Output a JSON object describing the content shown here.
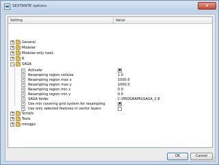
{
  "window": {
    "title": "SEXTANTE options",
    "close_label": "x"
  },
  "table": {
    "columns": [
      "Setting",
      "Value"
    ]
  },
  "tree": {
    "groups_before": [
      {
        "label": "General",
        "expander": "+"
      },
      {
        "label": "Modeler",
        "expander": "+"
      },
      {
        "label": "Modeler-only tools",
        "expander": "+"
      },
      {
        "label": "R",
        "expander": "+"
      }
    ],
    "saga": {
      "label": "SAGA",
      "expander": "-"
    },
    "saga_settings": [
      {
        "label": "Activate",
        "value": "",
        "checkbox": "checked"
      },
      {
        "label": "Resampling region cellsize",
        "value": "1.0"
      },
      {
        "label": "Resampling region max x",
        "value": "1000.0"
      },
      {
        "label": "Resampling region max y",
        "value": "1000.0"
      },
      {
        "label": "Resampling region min x",
        "value": "0.0"
      },
      {
        "label": "Resampling region min y",
        "value": "0.0"
      },
      {
        "label": "SAGA folder",
        "value": "C:\\PROGRAMS\\SAGA_2.8"
      },
      {
        "label": "Use min covering grid system for resampling",
        "value": "",
        "checkbox": "checked"
      },
      {
        "label": "Use only selected features in vector layers",
        "value": "",
        "checkbox": "unchecked"
      }
    ],
    "groups_after": [
      {
        "label": "Scripts",
        "expander": "+"
      },
      {
        "label": "Tools",
        "expander": "+"
      },
      {
        "label": "mmqgis",
        "expander": "+"
      }
    ]
  },
  "buttons": {
    "ok": "OK",
    "cancel": "Cancel"
  }
}
